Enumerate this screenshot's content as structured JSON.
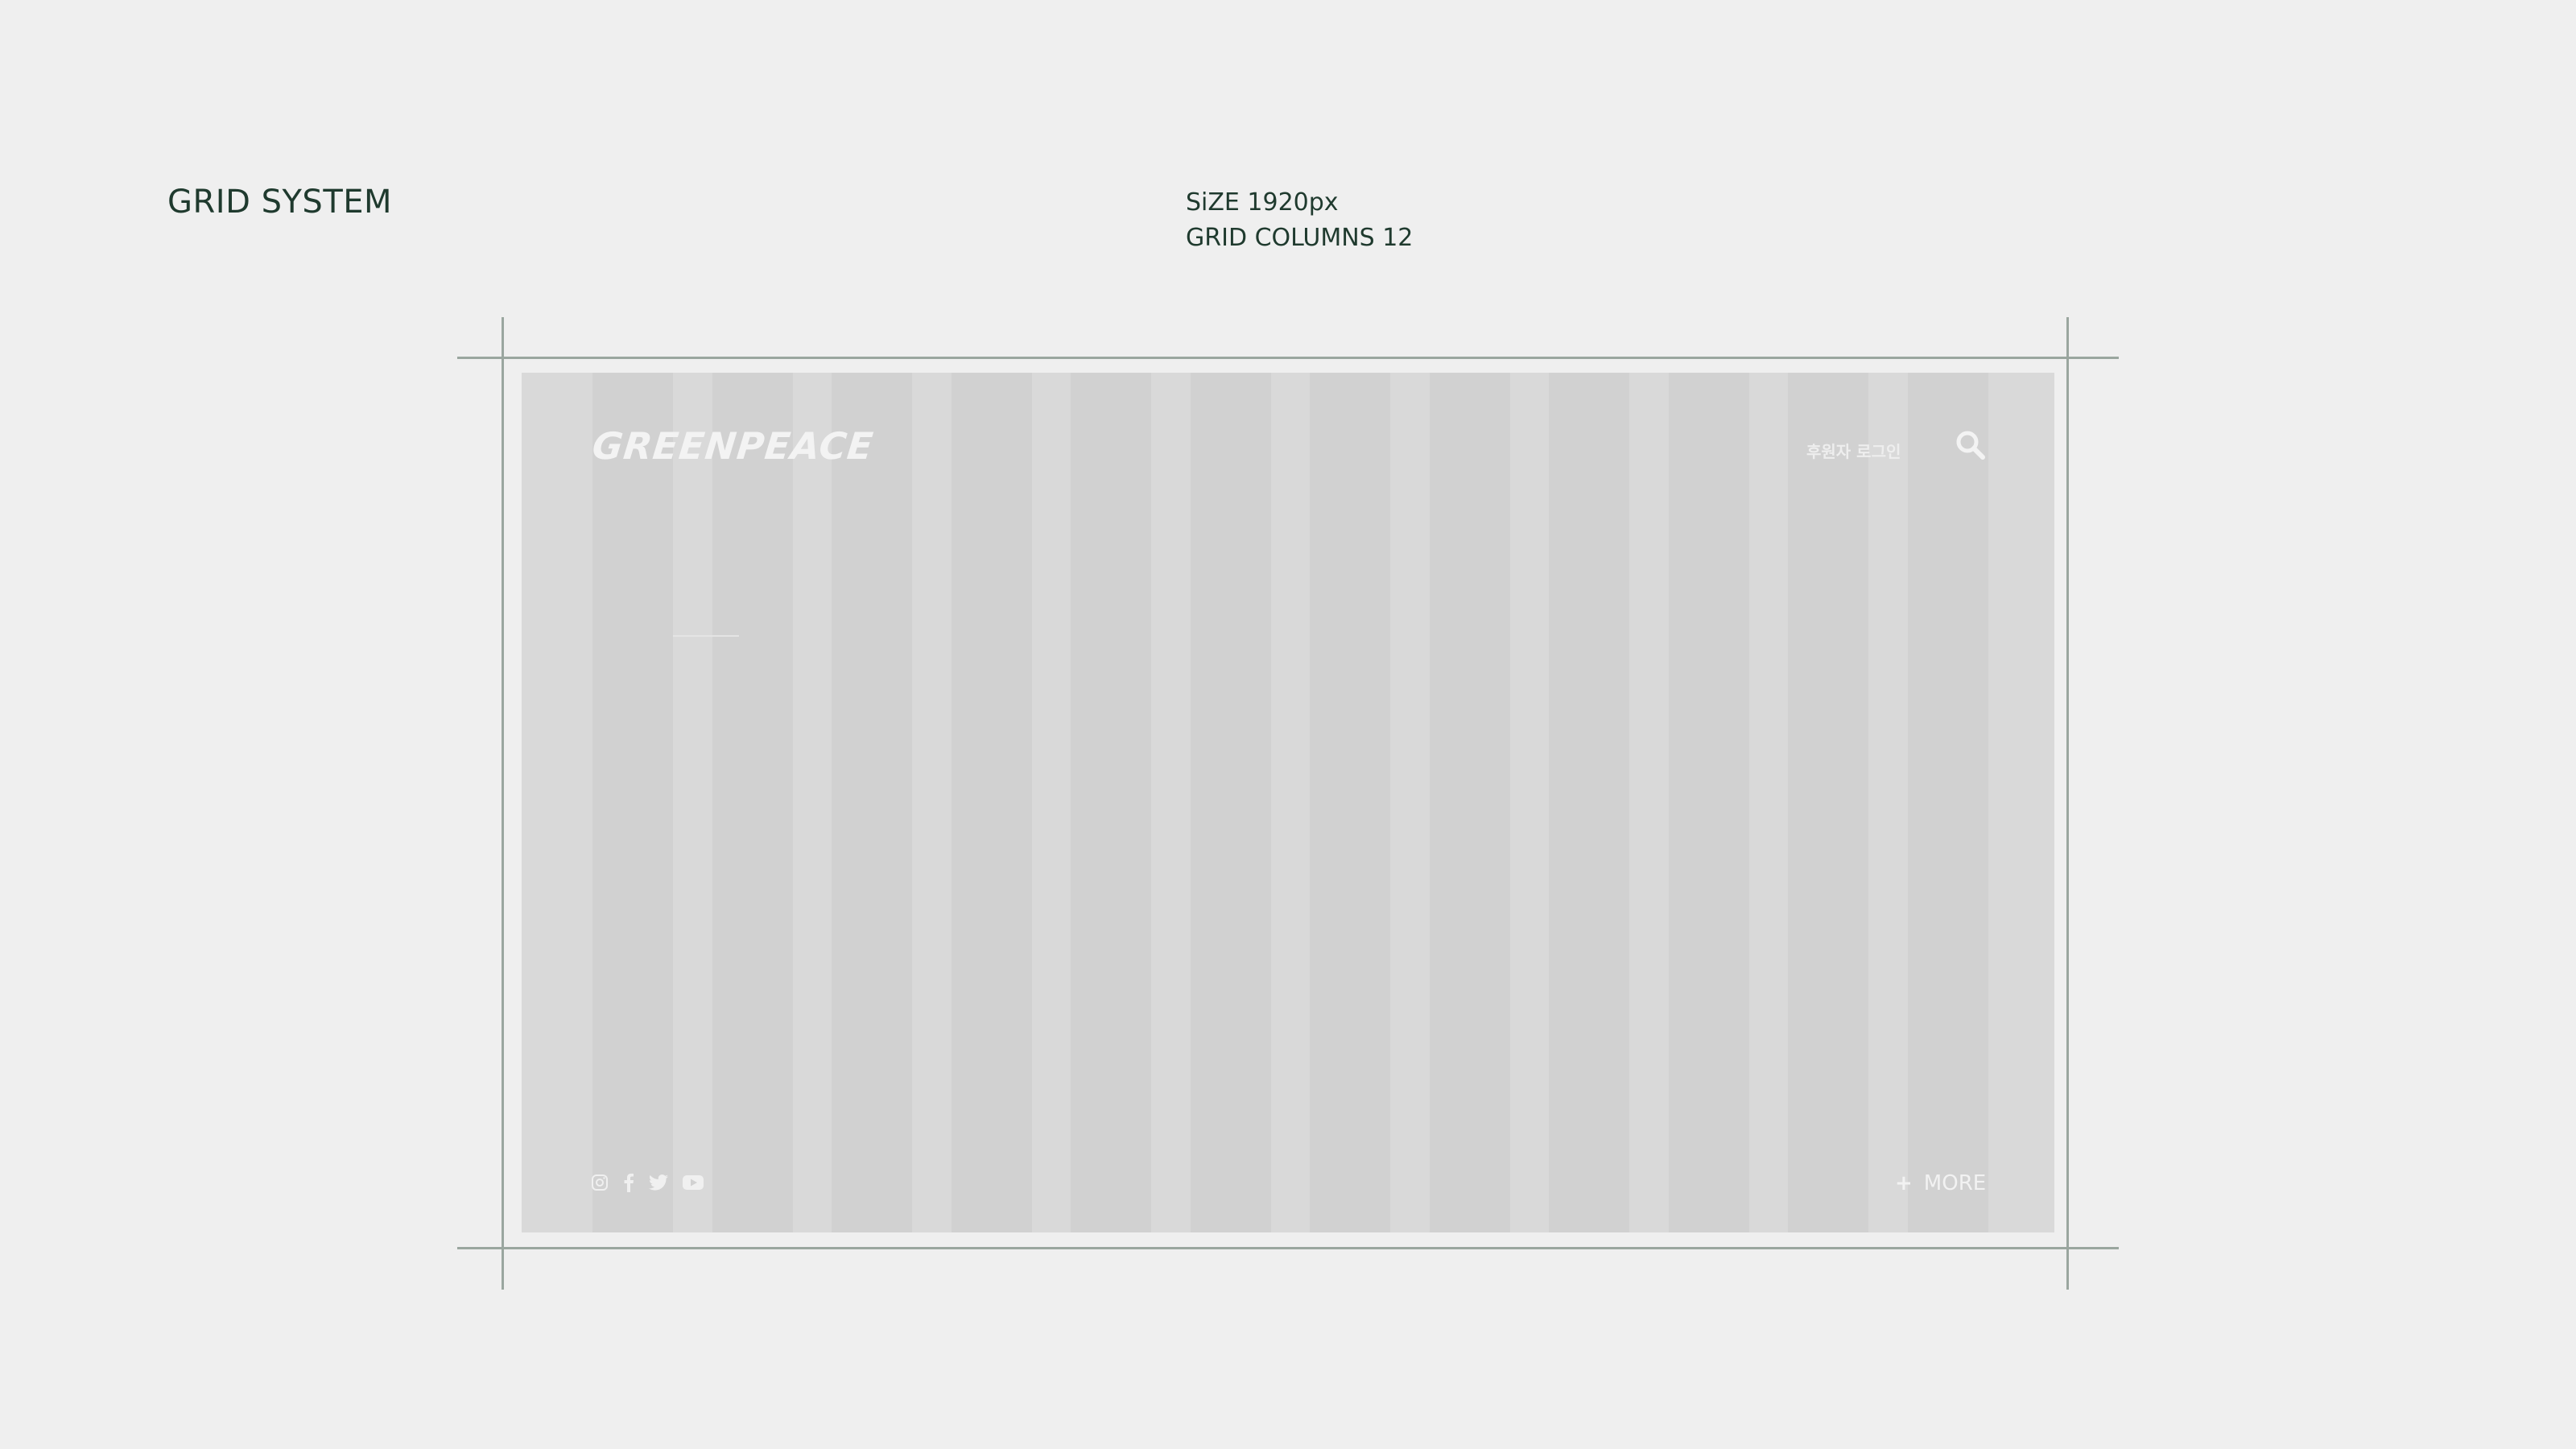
{
  "heading": "GRID SYSTEM",
  "spec": {
    "size": "SiZE 1920px",
    "columns": "GRID COLUMNS 12"
  },
  "mockup": {
    "logo": "GREENPEACE",
    "login": "후원자 로그인",
    "more_label": "MORE",
    "more_prefix": "+",
    "grid_columns": 12,
    "icons": [
      "search-icon",
      "instagram-icon",
      "facebook-icon",
      "twitter-icon",
      "youtube-icon",
      "plus-icon"
    ]
  },
  "colors": {
    "background": "#efefef",
    "text": "#1f3a2e",
    "guide": "#9aa69f",
    "frame": "#d9d9d9",
    "column": "#d1d1d1"
  }
}
